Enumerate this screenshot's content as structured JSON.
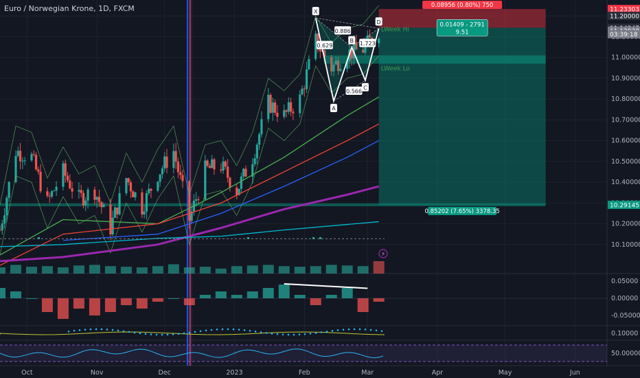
{
  "header": {
    "title": "Euro / Norwegian Krone, 1D, FXCM"
  },
  "colors": {
    "background": "#131722",
    "up": "#26a69a",
    "down": "#ef5350",
    "ema_green": "#4caf50",
    "ema_red": "#f44336",
    "ema_blue": "#2962ff",
    "ema_purple": "#9c27b0",
    "ema_teal": "#00bcd4",
    "bollinger": "#66bb6a",
    "pattern": "#ffffff",
    "target_zone": "#089981",
    "stop_zone": "#f23645",
    "rsi": "#29b6f6",
    "rsi_band": "#7e57c2"
  },
  "chart_data": [
    {
      "type": "candlestick",
      "symbol": "EUR/NOK",
      "ylim": [
        10.03,
        11.25
      ],
      "y_ticks": [
        10.1,
        10.2,
        10.3,
        10.4,
        10.5,
        10.6,
        10.7,
        10.8,
        10.9,
        11.0,
        11.1,
        11.2
      ],
      "y_tick_labels": [
        "10.10000",
        "10.20000",
        "10.30000",
        "10.40000",
        "10.50000",
        "10.60000",
        "10.70000",
        "10.80000",
        "10.90000",
        "11.00000",
        "11.10000",
        "11.20000"
      ],
      "x_labels": [
        {
          "label": "Oct",
          "date": "2022-10-01"
        },
        {
          "label": "Nov",
          "date": "2022-11-01"
        },
        {
          "label": "Dec",
          "date": "2022-12-01"
        },
        {
          "label": "2023",
          "date": "2023-01-01"
        },
        {
          "label": "Feb",
          "date": "2023-02-01"
        },
        {
          "label": "Mar",
          "date": "2023-03-01"
        },
        {
          "label": "Apr",
          "date": "2023-04-01"
        },
        {
          "label": "May",
          "date": "2023-05-01"
        },
        {
          "label": "Jun",
          "date": "2023-06-01"
        }
      ],
      "price_path": [
        [
          "2022-09-19",
          10.17
        ],
        [
          "2022-09-26",
          10.55
        ],
        [
          "2022-10-03",
          10.52
        ],
        [
          "2022-10-10",
          10.3
        ],
        [
          "2022-10-17",
          10.45
        ],
        [
          "2022-10-24",
          10.32
        ],
        [
          "2022-10-31",
          10.36
        ],
        [
          "2022-11-07",
          10.18
        ],
        [
          "2022-11-14",
          10.42
        ],
        [
          "2022-11-21",
          10.28
        ],
        [
          "2022-11-28",
          10.44
        ],
        [
          "2022-12-05",
          10.55
        ],
        [
          "2022-12-12",
          10.22
        ],
        [
          "2022-12-19",
          10.46
        ],
        [
          "2022-12-26",
          10.48
        ],
        [
          "2023-01-02",
          10.36
        ],
        [
          "2023-01-09",
          10.52
        ],
        [
          "2023-01-16",
          10.78
        ],
        [
          "2023-01-23",
          10.72
        ],
        [
          "2023-01-30",
          10.8
        ],
        [
          "2023-02-06",
          11.08
        ],
        [
          "2023-02-13",
          10.95
        ],
        [
          "2023-02-20",
          11.02
        ],
        [
          "2023-02-27",
          11.04
        ],
        [
          "2023-03-06",
          11.13
        ]
      ],
      "series": [
        {
          "name": "EMA 20",
          "color": "#4caf50",
          "points": [
            [
              "2022-09-19",
              10.05
            ],
            [
              "2022-10-17",
              10.22
            ],
            [
              "2022-11-28",
              10.2
            ],
            [
              "2022-12-26",
              10.35
            ],
            [
              "2023-01-23",
              10.52
            ],
            [
              "2023-02-20",
              10.72
            ],
            [
              "2023-03-06",
              10.81
            ]
          ]
        },
        {
          "name": "EMA 50",
          "color": "#f44336",
          "points": [
            [
              "2022-09-19",
              10.0
            ],
            [
              "2022-10-17",
              10.15
            ],
            [
              "2022-11-28",
              10.2
            ],
            [
              "2022-12-26",
              10.3
            ],
            [
              "2023-01-23",
              10.45
            ],
            [
              "2023-02-20",
              10.6
            ],
            [
              "2023-03-06",
              10.68
            ]
          ]
        },
        {
          "name": "EMA 100",
          "color": "#2962ff",
          "points": [
            [
              "2022-10-17",
              10.12
            ],
            [
              "2022-11-28",
              10.15
            ],
            [
              "2022-12-26",
              10.25
            ],
            [
              "2023-01-23",
              10.38
            ],
            [
              "2023-02-20",
              10.52
            ],
            [
              "2023-03-06",
              10.6
            ]
          ]
        },
        {
          "name": "EMA 200",
          "color": "#9c27b0",
          "points": [
            [
              "2022-09-19",
              10.02
            ],
            [
              "2022-10-17",
              10.04
            ],
            [
              "2022-11-28",
              10.1
            ],
            [
              "2022-12-26",
              10.18
            ],
            [
              "2023-01-23",
              10.27
            ],
            [
              "2023-02-20",
              10.34
            ],
            [
              "2023-03-06",
              10.38
            ]
          ]
        },
        {
          "name": "EMA 300",
          "color": "#00bcd4",
          "points": [
            [
              "2022-09-19",
              10.09
            ],
            [
              "2022-10-17",
              10.1
            ],
            [
              "2022-11-28",
              10.13
            ],
            [
              "2022-12-26",
              10.14
            ],
            [
              "2023-01-23",
              10.17
            ],
            [
              "2023-03-06",
              10.21
            ]
          ]
        }
      ],
      "price_labels": [
        {
          "text": "11.23303",
          "value": 11.233,
          "color": "#f23645"
        },
        {
          "text": "11.20000",
          "value": 11.2,
          "color": "#2a2e39"
        },
        {
          "text": "11.14347",
          "value": 11.143,
          "color": "#2a2e39"
        },
        {
          "text": "11.12938",
          "value": 11.129,
          "color": "#787b86"
        },
        {
          "text": "03:39:18",
          "value": 11.112,
          "color": "#787b86"
        },
        {
          "text": "10.29145",
          "value": 10.291,
          "color": "#089981"
        }
      ],
      "position": {
        "entry": 11.143,
        "stop": 11.233,
        "target": 10.291,
        "start": "2023-03-06",
        "end": "2023-05-19",
        "stop_label": "0.08956 (0.80%) 750",
        "target_label": "0.85202 (7.65%) 3378.35",
        "entry_label_line1": "0.01409 - 2791",
        "entry_label_line2": "9.51"
      },
      "levels": [
        {
          "name": "Week Hi",
          "text": "LWeek Hi",
          "value": 11.14
        },
        {
          "name": "Week Lo",
          "text": "LWeek Lo",
          "value": 10.95
        }
      ],
      "harmonic": {
        "points": [
          {
            "label": "X",
            "date": "2023-02-06",
            "value": 11.19
          },
          {
            "label": "A",
            "date": "2023-02-14",
            "value": 10.79
          },
          {
            "label": "B",
            "date": "2023-02-22",
            "value": 11.05
          },
          {
            "label": "C",
            "date": "2023-02-28",
            "value": 10.89
          },
          {
            "label": "D",
            "date": "2023-03-06",
            "value": 11.14
          }
        ],
        "ratios": [
          {
            "text": "0.629",
            "date": "2023-02-10",
            "value": 11.06
          },
          {
            "text": "0.886",
            "date": "2023-02-18",
            "value": 11.13
          },
          {
            "text": "1.723",
            "date": "2023-03-01",
            "value": 11.07
          },
          {
            "text": "0.566",
            "date": "2023-02-23",
            "value": 10.84
          }
        ]
      }
    },
    {
      "type": "bar",
      "name": "Volume",
      "ylim": [
        0,
        1
      ],
      "values_note": "",
      "shape": [
        0.5,
        0.7,
        0.55,
        0.6,
        0.5,
        0.65,
        0.7,
        0.6,
        0.55,
        0.5,
        0.6,
        0.75,
        0.5,
        0.55,
        0.4,
        0.6,
        0.65,
        0.7,
        0.6,
        0.55,
        0.6,
        0.7,
        0.65,
        0.6,
        1.0
      ]
    },
    {
      "type": "bar",
      "name": "Oscillator",
      "ylim": [
        -0.08,
        0.07
      ],
      "y_ticks": [
        0.05,
        0.0,
        -0.05
      ],
      "y_tick_labels": [
        "0.05000",
        "0.00000",
        "-0.05000"
      ],
      "values": [
        [
          "2022-09-19",
          0.03
        ],
        [
          "2022-09-26",
          0.02
        ],
        [
          "2022-10-03",
          0.0
        ],
        [
          "2022-10-10",
          -0.04
        ],
        [
          "2022-10-17",
          -0.06
        ],
        [
          "2022-10-24",
          -0.03
        ],
        [
          "2022-10-31",
          -0.05
        ],
        [
          "2022-11-07",
          -0.04
        ],
        [
          "2022-11-14",
          -0.02
        ],
        [
          "2022-11-21",
          -0.03
        ],
        [
          "2022-11-28",
          -0.01
        ],
        [
          "2022-12-05",
          0.0
        ],
        [
          "2022-12-12",
          -0.02
        ],
        [
          "2022-12-19",
          0.01
        ],
        [
          "2022-12-26",
          0.02
        ],
        [
          "2023-01-02",
          0.01
        ],
        [
          "2023-01-09",
          0.02
        ],
        [
          "2023-01-16",
          0.03
        ],
        [
          "2023-01-23",
          0.04
        ],
        [
          "2023-01-30",
          0.01
        ],
        [
          "2023-02-06",
          -0.02
        ],
        [
          "2023-02-13",
          0.01
        ],
        [
          "2023-02-20",
          0.03
        ],
        [
          "2023-02-27",
          -0.04
        ],
        [
          "2023-03-06",
          -0.01
        ]
      ],
      "trendline": [
        [
          "2023-01-23",
          0.042
        ],
        [
          "2023-03-01",
          0.029
        ]
      ]
    },
    {
      "type": "line",
      "name": "Indicator",
      "ylim": [
        0.08,
        0.125
      ],
      "y_ticks": [
        0.1
      ],
      "y_tick_labels": [
        "0.10000"
      ]
    },
    {
      "type": "line",
      "name": "RSI",
      "ylim": [
        20,
        80
      ],
      "y_ticks": [
        50
      ],
      "y_tick_labels": [
        "50.00000"
      ]
    }
  ]
}
